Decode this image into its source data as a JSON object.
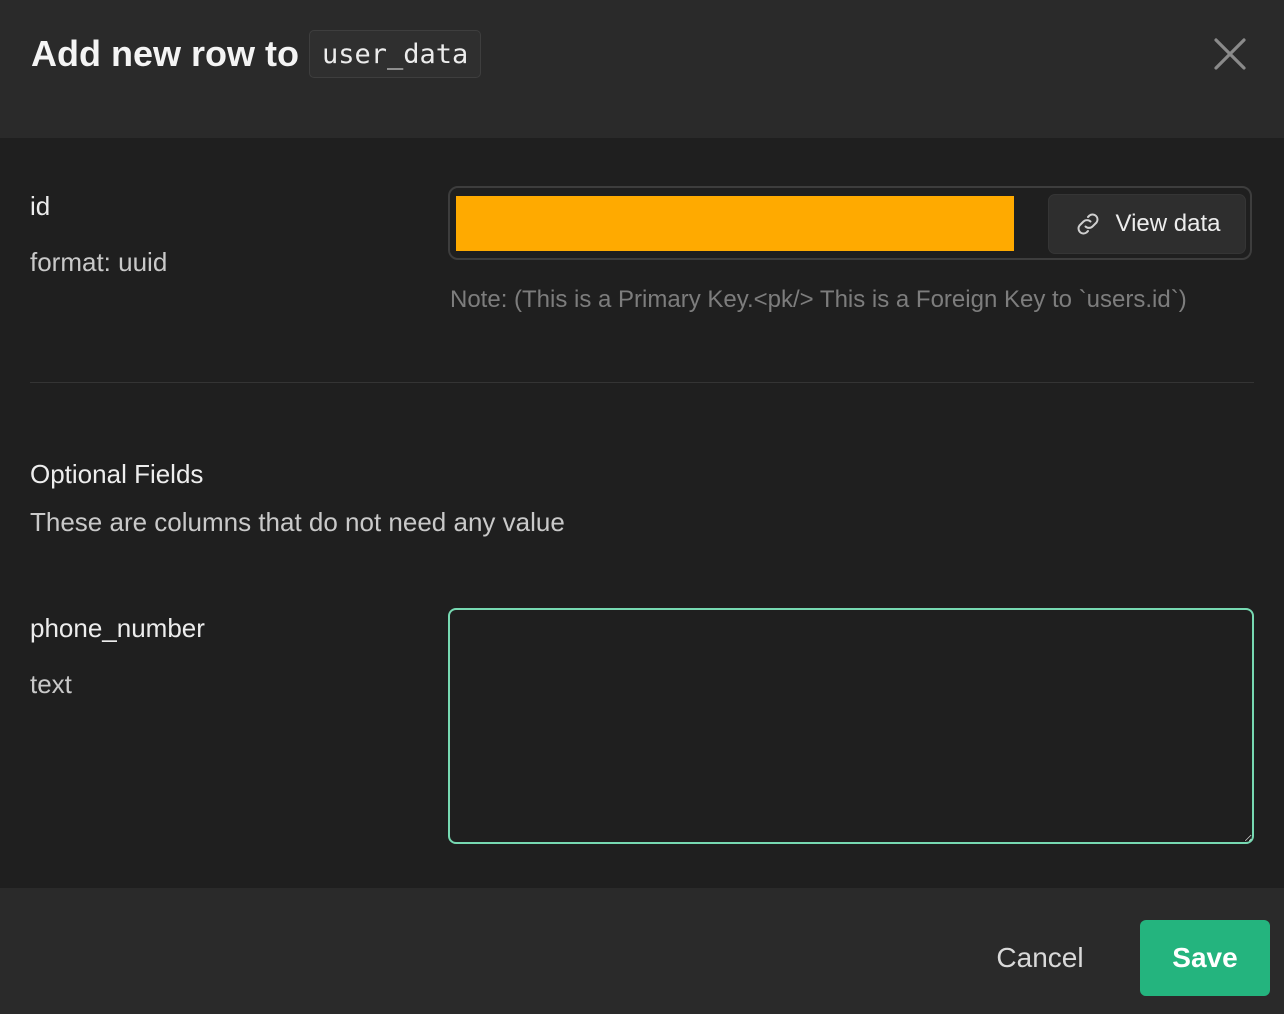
{
  "header": {
    "title": "Add new row to",
    "table_name": "user_data",
    "close_icon": "close-icon"
  },
  "fields": {
    "id": {
      "name": "id",
      "format": "format: uuid",
      "value_highlight_color": "#ffaa00",
      "view_data_label": "View data",
      "view_data_icon": "link-icon",
      "note": "Note: (This is a Primary Key.<pk/> This is a Foreign Key to `users.id`)"
    },
    "optional_section": {
      "title": "Optional Fields",
      "description": "These are columns that do not need any value"
    },
    "phone_number": {
      "name": "phone_number",
      "format": "text",
      "value": ""
    }
  },
  "footer": {
    "cancel_label": "Cancel",
    "save_label": "Save",
    "save_color": "#24b47e"
  }
}
